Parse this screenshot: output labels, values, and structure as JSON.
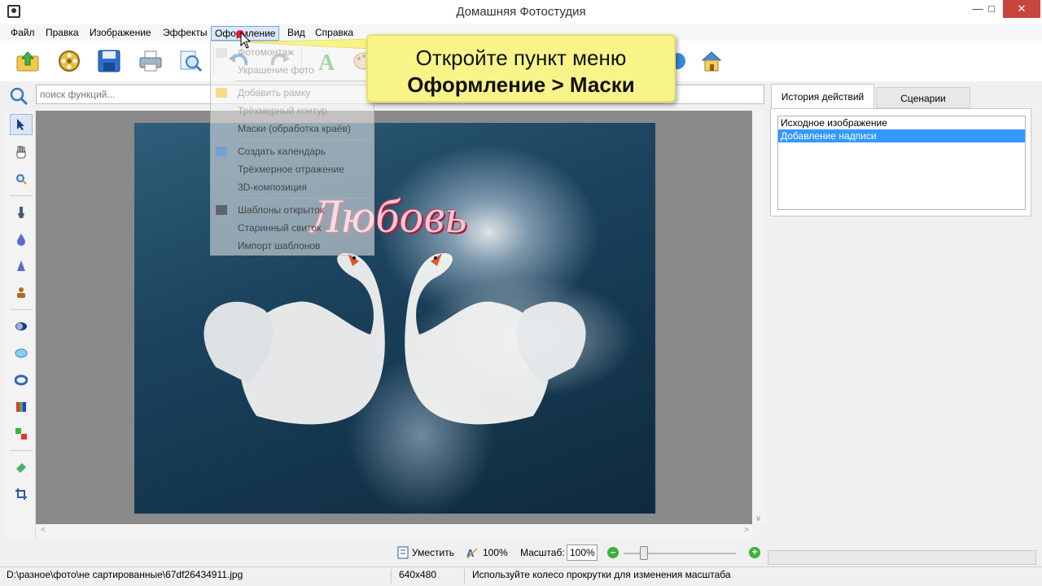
{
  "window": {
    "title": "Домашняя Фотостудия"
  },
  "menu": {
    "items": [
      "Файл",
      "Правка",
      "Изображение",
      "Эффекты",
      "Оформление",
      "Вид",
      "Справка"
    ]
  },
  "dropdown": {
    "items": [
      {
        "label": "Фотомонтаж"
      },
      {
        "label": "Украшение фото"
      },
      {
        "label": "Добавить рамку"
      },
      {
        "label": "Трёхмерный контур"
      },
      {
        "label": "Маски (обработка краёв)"
      },
      {
        "label": "Создать календарь"
      },
      {
        "label": "Трёхмерное отражение"
      },
      {
        "label": "3D-композиция"
      },
      {
        "label": "Шаблоны открыток"
      },
      {
        "label": "Старинный свиток"
      },
      {
        "label": "Импорт шаблонов"
      }
    ]
  },
  "callout": {
    "line1": "Откройте пункт меню",
    "line2": "Оформление > Маски"
  },
  "search": {
    "placeholder": "поиск функций..."
  },
  "photo": {
    "caption": "Любовь"
  },
  "panel": {
    "tabs": [
      "История действий",
      "Сценарии"
    ],
    "history": [
      "Исходное изображение",
      "Добавление надписи"
    ]
  },
  "zoombar": {
    "fit_label": "Уместить",
    "actual_label": "100%",
    "scale_label": "Масштаб:",
    "scale_value": "100%",
    "slider_level_percent": 18
  },
  "status": {
    "path": "D:\\разное\\фото\\не сартированные\\67df26434911.jpg",
    "size": "640x480",
    "hint": "Используйте колесо прокрутки для изменения масштаба"
  },
  "colors": {
    "accent_selection": "#3399ff",
    "callout_bg": "#f8f48a",
    "close_button": "#c7453c"
  }
}
